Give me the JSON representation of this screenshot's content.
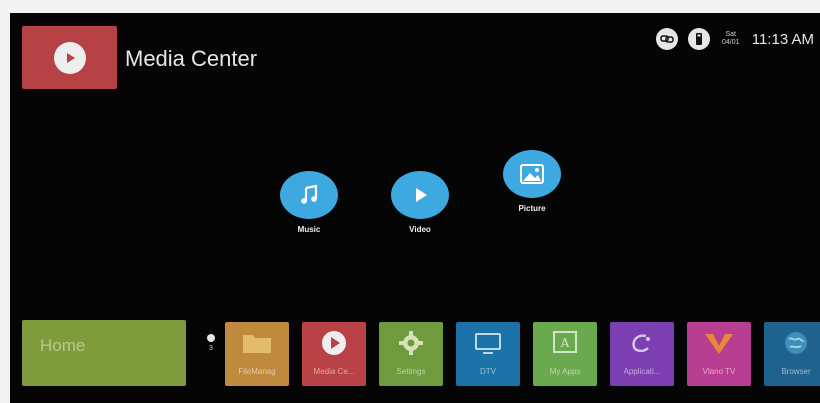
{
  "header": {
    "title": "Media Center",
    "icon": "play-icon"
  },
  "status": {
    "icons": [
      "network-icon",
      "usb-icon"
    ],
    "day": "Sat",
    "date": "04/01",
    "time": "11:13 AM"
  },
  "media_items": [
    {
      "label": "Music",
      "icon": "music-note-icon"
    },
    {
      "label": "Video",
      "icon": "play-icon"
    },
    {
      "label": "Picture",
      "icon": "picture-icon"
    }
  ],
  "dock": {
    "home_label": "Home",
    "page_number": "3",
    "tiles": [
      {
        "label": "FileManag",
        "icon": "folder-icon",
        "color": "#c08a3e"
      },
      {
        "label": "Media Ce...",
        "icon": "play-icon",
        "color": "#b84246"
      },
      {
        "label": "Settings",
        "icon": "gear-icon",
        "color": "#6f9b3e"
      },
      {
        "label": "DTV",
        "icon": "tv-icon",
        "color": "#1b72a6"
      },
      {
        "label": "My Apps",
        "icon": "apps-icon",
        "color": "#6aa94e"
      },
      {
        "label": "Applicati...",
        "icon": "app-store-icon",
        "color": "#7c3fb1"
      },
      {
        "label": "Vlano TV",
        "icon": "vlano-icon",
        "color": "#b83e92"
      },
      {
        "label": "Browser",
        "icon": "globe-icon",
        "color": "#20628e"
      }
    ]
  },
  "colors": {
    "accent_blue": "#3ea8e0",
    "home_tile": "#7f9c3d",
    "background": "#050505"
  }
}
